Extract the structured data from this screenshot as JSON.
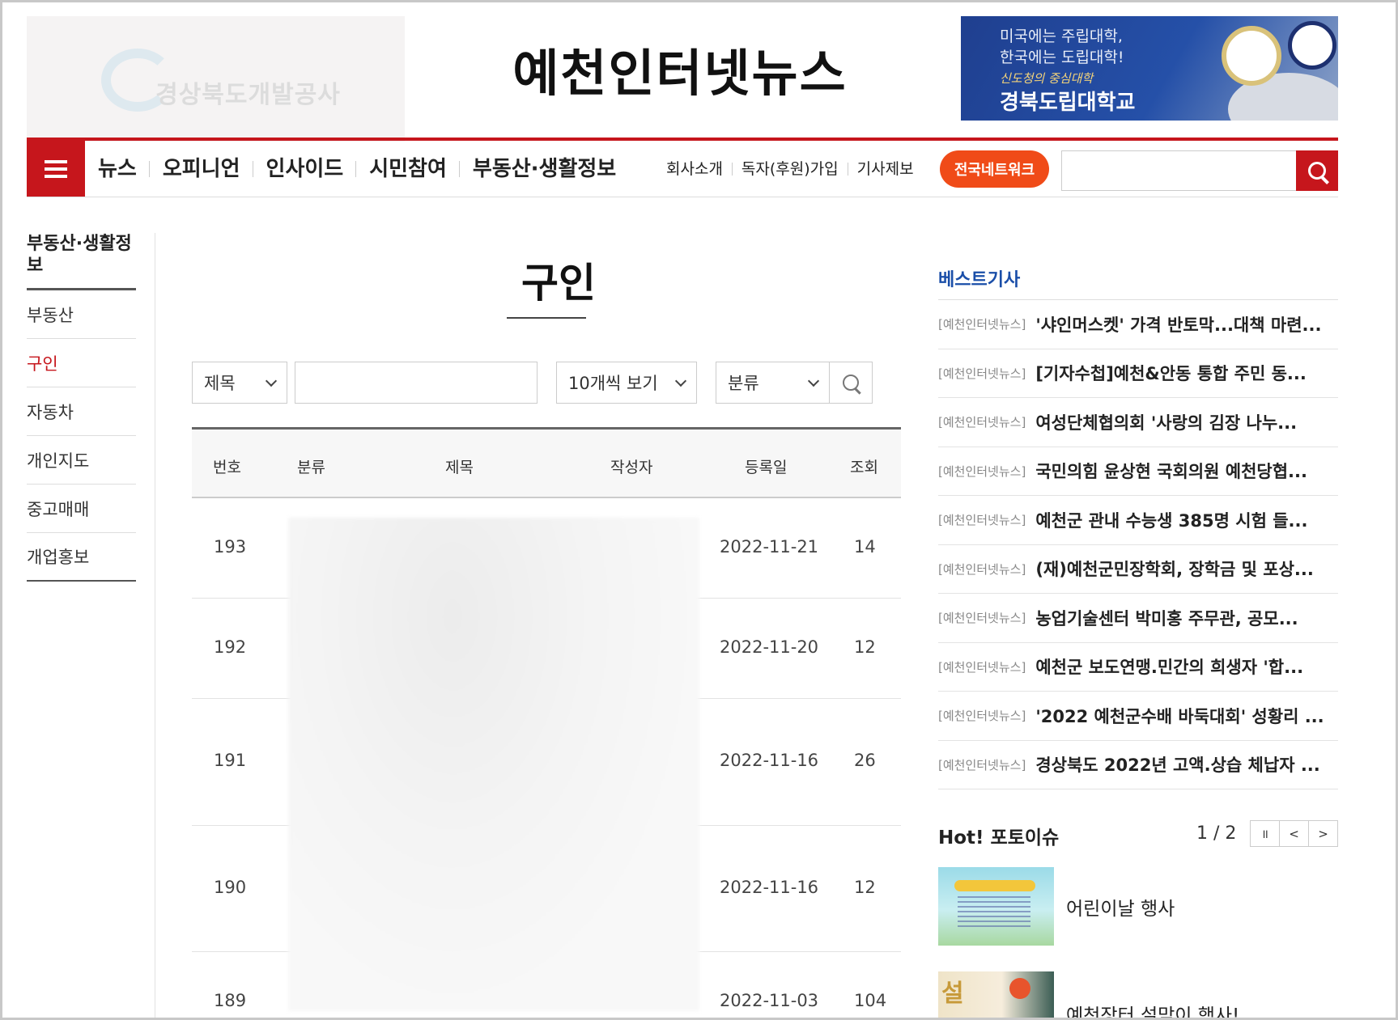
{
  "header": {
    "left_ad": {
      "logo_text": "경상북도개발공사"
    },
    "site_title": "예천인터넷뉴스",
    "right_ad": {
      "line1": "미국에는 주립대학,",
      "line2": "한국에는 도립대학!",
      "line3": "신도청의 중심대학",
      "line4": "경북도립대학교"
    }
  },
  "nav": {
    "main": [
      "뉴스",
      "오피니언",
      "인사이드",
      "시민참여",
      "부동산·생활정보"
    ],
    "sub": [
      "회사소개",
      "독자(후원)가입",
      "기사제보"
    ],
    "network_button": "전국네트워크",
    "search_placeholder": ""
  },
  "sidebar": {
    "title": "부동산·생활정보",
    "items": [
      {
        "label": "부동산",
        "active": false
      },
      {
        "label": "구인",
        "active": true
      },
      {
        "label": "자동차",
        "active": false
      },
      {
        "label": "개인지도",
        "active": false
      },
      {
        "label": "중고매매",
        "active": false
      },
      {
        "label": "개업홍보",
        "active": false
      }
    ]
  },
  "main": {
    "page_title": "구인",
    "filters": {
      "field_select": "제목",
      "keyword": "",
      "page_size": "10개씩 보기",
      "category": "분류"
    },
    "table": {
      "headers": [
        "번호",
        "분류",
        "제목",
        "작성자",
        "등록일",
        "조회"
      ],
      "rows": [
        {
          "no": "193",
          "date": "2022-11-21",
          "views": "14"
        },
        {
          "no": "192",
          "date": "2022-11-20",
          "views": "12"
        },
        {
          "no": "191",
          "date": "2022-11-16",
          "views": "26"
        },
        {
          "no": "190",
          "date": "2022-11-16",
          "views": "12"
        },
        {
          "no": "189",
          "date": "2022-11-03",
          "views": "104"
        }
      ]
    }
  },
  "best": {
    "title": "베스트기사",
    "source": "[예천인터넷뉴스]",
    "items": [
      "'샤인머스켓' 가격 반토막...대책 마련...",
      "[기자수첩]예천&안동 통합 주민 동...",
      "여성단체협의회 '사랑의 김장 나누...",
      "국민의힘 윤상현 국회의원 예천당협...",
      "예천군 관내 수능생 385명 시험 들...",
      "(재)예천군민장학회, 장학금 및 포상...",
      "농업기술센터 박미홍 주무관, 공모...",
      "예천군 보도연맹.민간의 희생자 '합...",
      "'2022 예천군수배 바둑대회' 성황리 ...",
      "경상북도 2022년 고액.상습 체납자 ..."
    ]
  },
  "hot": {
    "title": "Hot! 포토이슈",
    "pager": "1 / 2",
    "buttons": [
      "॥",
      "<",
      ">"
    ],
    "photos": [
      {
        "caption": "어린이날 행사"
      },
      {
        "caption": "예천장터 설맞이 행사!",
        "thumb_text": "설"
      }
    ]
  }
}
